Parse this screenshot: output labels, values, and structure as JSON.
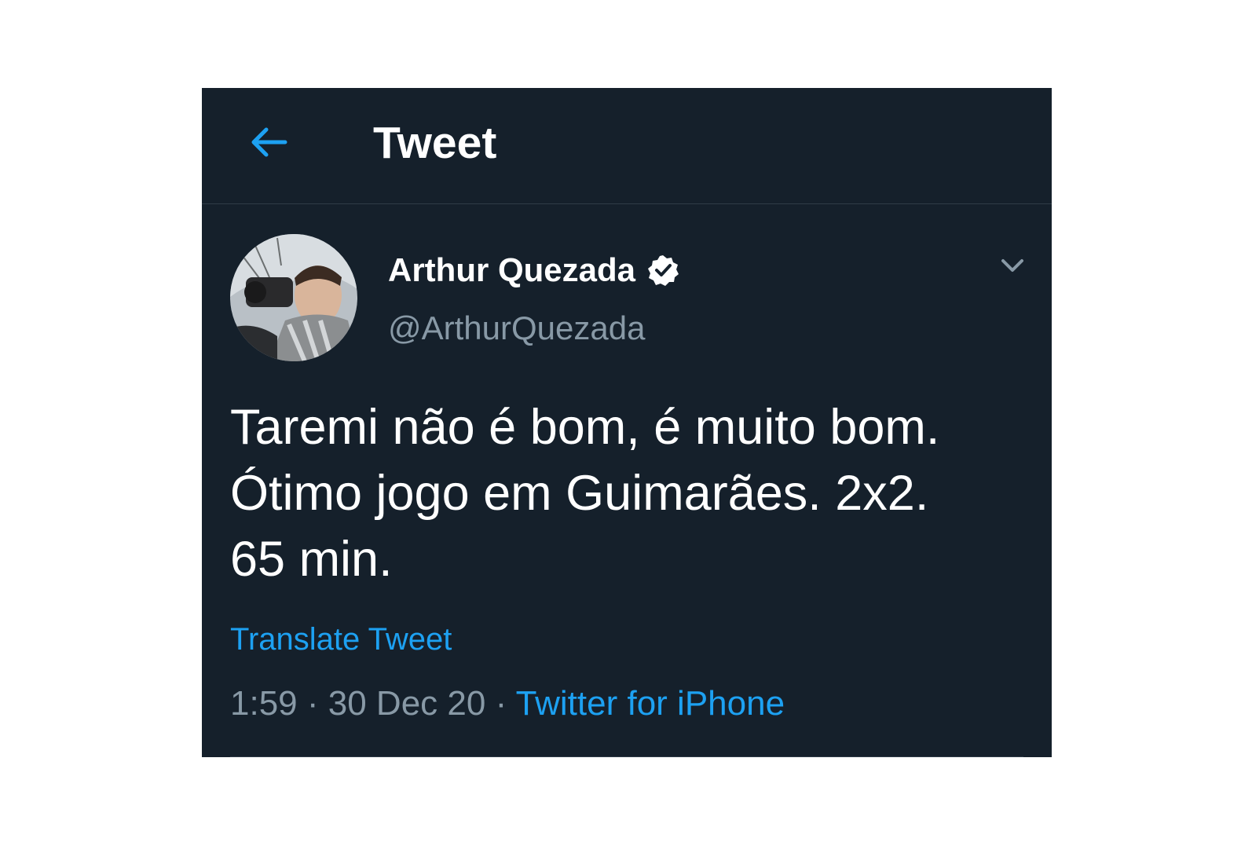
{
  "header": {
    "title": "Tweet",
    "back_icon": "arrow-left-icon"
  },
  "tweet": {
    "author": {
      "display_name": "Arthur Quezada",
      "handle": "@ArthurQuezada",
      "verified": true,
      "verified_icon": "verified-badge-icon"
    },
    "menu_icon": "chevron-down-icon",
    "text_lines": [
      "Taremi não é bom, é muito bom.",
      "Ótimo jogo em Guimarães. 2x2.",
      "65 min."
    ],
    "translate_label": "Translate Tweet",
    "time": "1:59",
    "separator": "·",
    "date": "30 Dec 20",
    "source": "Twitter for iPhone"
  },
  "colors": {
    "background": "#15202b",
    "accent": "#1da1f2",
    "secondary_text": "#8899a6",
    "primary_text": "#ffffff",
    "divider": "#2f3b47"
  }
}
